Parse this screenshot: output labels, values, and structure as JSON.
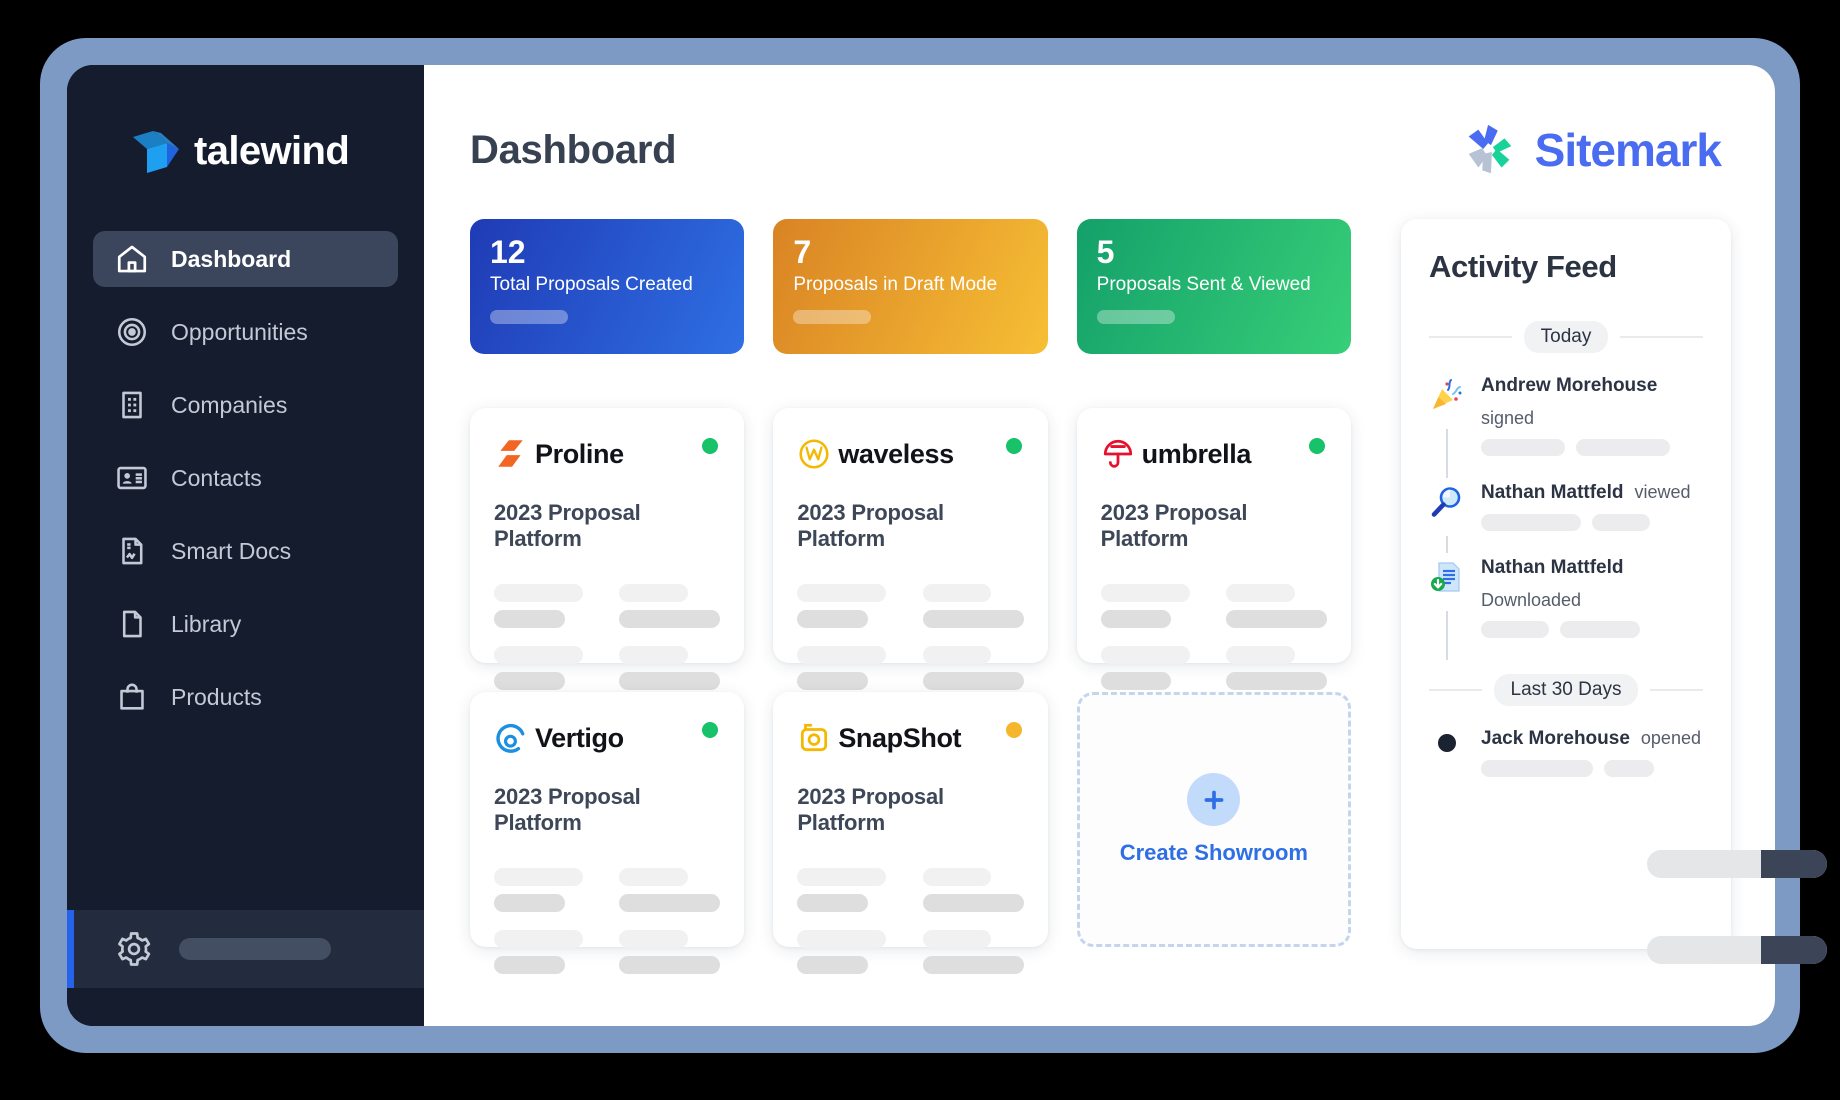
{
  "brand": {
    "name": "talewind",
    "logo_icon": "talewind-arrow-logo"
  },
  "sidebar": {
    "items": [
      {
        "label": "Dashboard",
        "icon": "home-icon",
        "active": true
      },
      {
        "label": "Opportunities",
        "icon": "target-icon",
        "active": false
      },
      {
        "label": "Companies",
        "icon": "building-icon",
        "active": false
      },
      {
        "label": "Contacts",
        "icon": "contact-card-icon",
        "active": false
      },
      {
        "label": "Smart Docs",
        "icon": "smart-document-icon",
        "active": false
      },
      {
        "label": "Library",
        "icon": "file-icon",
        "active": false
      },
      {
        "label": "Products",
        "icon": "shopping-bag-icon",
        "active": false
      }
    ],
    "footer": {
      "icon": "gear-icon"
    },
    "accent_color": "#2563eb",
    "background_color": "#141c2e"
  },
  "header": {
    "title": "Dashboard",
    "client": {
      "name": "Sitemark",
      "logo_icon": "sitemark-pinwheel-icon",
      "color": "#4a6cf0"
    }
  },
  "stats": [
    {
      "value": "12",
      "label": "Total Proposals Created",
      "color_from": "#1f3bb5",
      "color_to": "#2f6fe4"
    },
    {
      "value": "7",
      "label": "Proposals in Draft Mode",
      "color_from": "#d98324",
      "color_to": "#f7bf35"
    },
    {
      "value": "5",
      "label": "Proposals Sent & Viewed",
      "color_from": "#14a06a",
      "color_to": "#37cf78"
    }
  ],
  "proposals": [
    {
      "company": "Proline",
      "logo_icon": "proline-bolt-icon",
      "logo_color": "#f26522",
      "title": "2023 Proposal Platform",
      "status": "active",
      "status_color": "#17c268"
    },
    {
      "company": "waveless",
      "logo_icon": "waveless-wave-icon",
      "logo_color": "#f5b800",
      "title": "2023 Proposal Platform",
      "status": "active",
      "status_color": "#17c268"
    },
    {
      "company": "umbrella",
      "logo_icon": "umbrella-icon",
      "logo_color": "#e8112d",
      "title": "2023 Proposal Platform",
      "status": "active",
      "status_color": "#17c268"
    },
    {
      "company": "Vertigo",
      "logo_icon": "vertigo-spiral-icon",
      "logo_color": "#1d8fe0",
      "title": "2023 Proposal Platform",
      "status": "active",
      "status_color": "#17c268"
    },
    {
      "company": "SnapShot",
      "logo_icon": "snapshot-camera-icon",
      "logo_color": "#f5b800",
      "title": "2023 Proposal Platform",
      "status": "pending",
      "status_color": "#f5b62c"
    }
  ],
  "create_card": {
    "label": "Create Showroom",
    "icon": "plus-icon",
    "color": "#2f6fe4"
  },
  "activity_feed": {
    "title": "Activity Feed",
    "groups": [
      {
        "label": "Today",
        "items": [
          {
            "name": "Andrew Morehouse",
            "action": "signed",
            "icon": "party-popper-icon"
          },
          {
            "name": "Nathan Mattfeld",
            "action": "viewed",
            "icon": "magnifier-icon"
          },
          {
            "name": "Nathan Mattfeld",
            "action": "Downloaded",
            "icon": "document-download-icon"
          }
        ]
      },
      {
        "label": "Last 30 Days",
        "items": [
          {
            "name": "Jack Morehouse",
            "action": "opened",
            "icon": "dot-marker-icon"
          }
        ]
      }
    ]
  }
}
